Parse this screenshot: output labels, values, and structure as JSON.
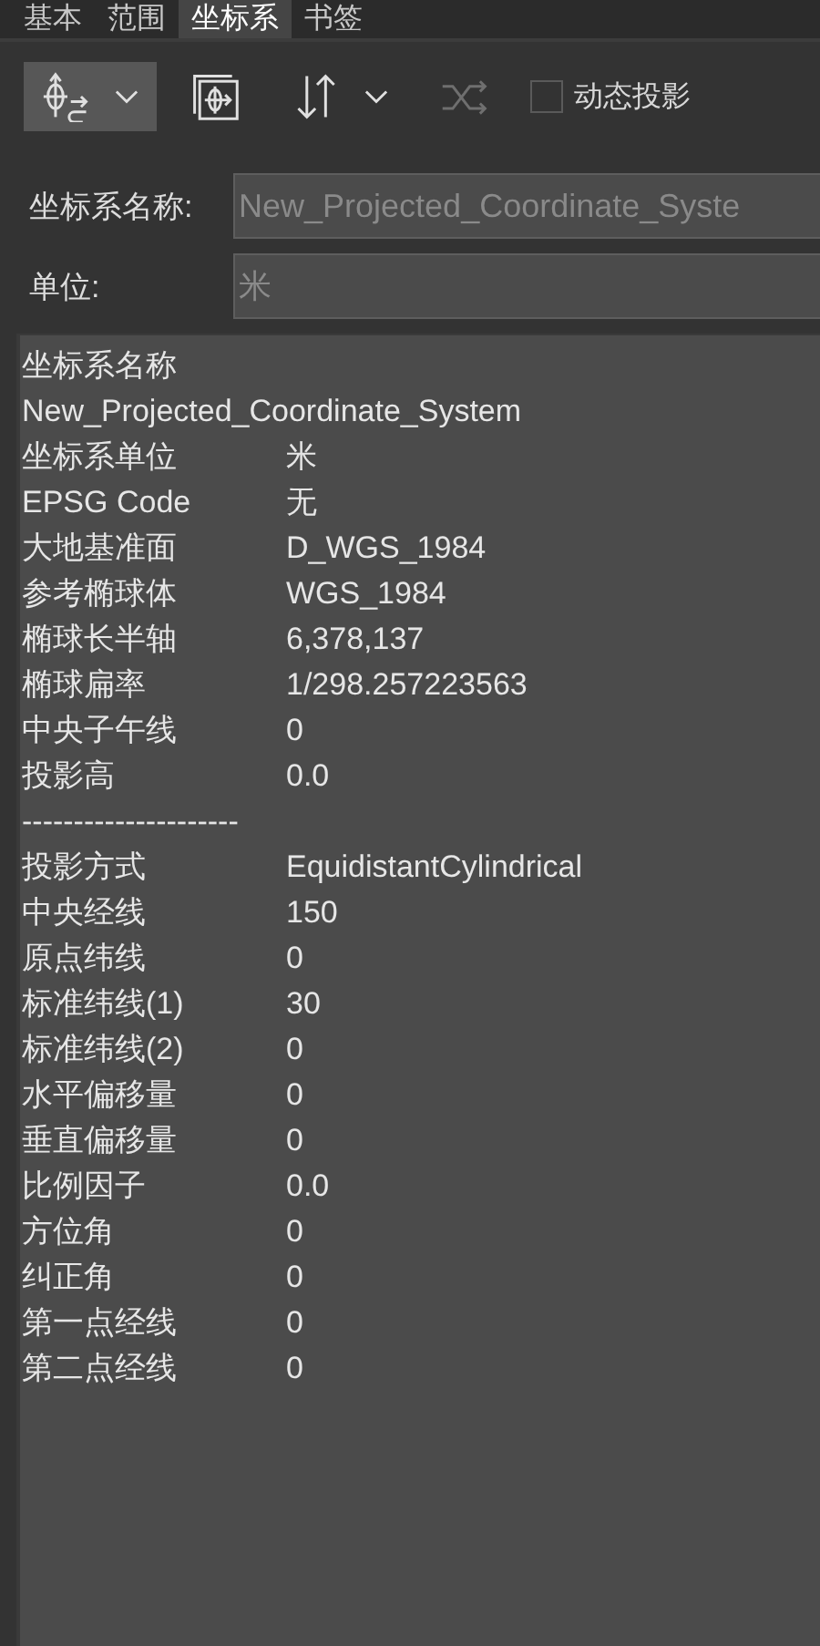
{
  "tabs": [
    {
      "label": "基本",
      "selected": false
    },
    {
      "label": "范围",
      "selected": false
    },
    {
      "label": "坐标系",
      "selected": true
    },
    {
      "label": "书签",
      "selected": false
    }
  ],
  "toolbar": [
    {
      "kind": "button",
      "pressed": true,
      "disabled": false
    },
    {
      "kind": "button",
      "pressed": false,
      "disabled": false
    },
    {
      "kind": "button",
      "pressed": false,
      "disabled": false
    },
    {
      "kind": "button",
      "pressed": false,
      "disabled": true
    },
    {
      "kind": "checkbox",
      "label": "动态投影",
      "checked": false
    }
  ],
  "fields": [
    {
      "label": "坐标系名称:",
      "value": "New_Projected_Coordinate_Syste",
      "disabled": true
    },
    {
      "label": "单位:",
      "value": "米",
      "disabled": true
    }
  ],
  "info": [
    {
      "kind": "line",
      "text": "坐标系名称"
    },
    {
      "kind": "line",
      "text": "New_Projected_Coordinate_System"
    },
    {
      "kind": "pair",
      "label": "坐标系单位",
      "value": "米"
    },
    {
      "kind": "pair",
      "label": "EPSG Code",
      "value": "无"
    },
    {
      "kind": "pair",
      "label": "大地基准面",
      "value": "D_WGS_1984"
    },
    {
      "kind": "pair",
      "label": "参考椭球体",
      "value": "WGS_1984"
    },
    {
      "kind": "pair",
      "label": "椭球长半轴",
      "value": "6,378,137"
    },
    {
      "kind": "pair",
      "label": "椭球扁率",
      "value": "1/298.257223563"
    },
    {
      "kind": "pair",
      "label": "中央子午线",
      "value": "0"
    },
    {
      "kind": "pair",
      "label": "投影高",
      "value": "0.0"
    },
    {
      "kind": "line",
      "text": "---------------------"
    },
    {
      "kind": "pair",
      "label": "投影方式",
      "value": "EquidistantCylindrical"
    },
    {
      "kind": "pair",
      "label": "中央经线",
      "value": "150"
    },
    {
      "kind": "pair",
      "label": "原点纬线",
      "value": "0"
    },
    {
      "kind": "pair",
      "label": "标准纬线(1)",
      "value": "30"
    },
    {
      "kind": "pair",
      "label": "标准纬线(2)",
      "value": "0"
    },
    {
      "kind": "pair",
      "label": "水平偏移量",
      "value": "0"
    },
    {
      "kind": "pair",
      "label": "垂直偏移量",
      "value": "0"
    },
    {
      "kind": "pair",
      "label": "比例因子",
      "value": "0.0"
    },
    {
      "kind": "pair",
      "label": "方位角",
      "value": "0"
    },
    {
      "kind": "pair",
      "label": "纠正角",
      "value": "0"
    },
    {
      "kind": "pair",
      "label": "第一点经线",
      "value": "0"
    },
    {
      "kind": "pair",
      "label": "第二点经线",
      "value": "0"
    }
  ]
}
